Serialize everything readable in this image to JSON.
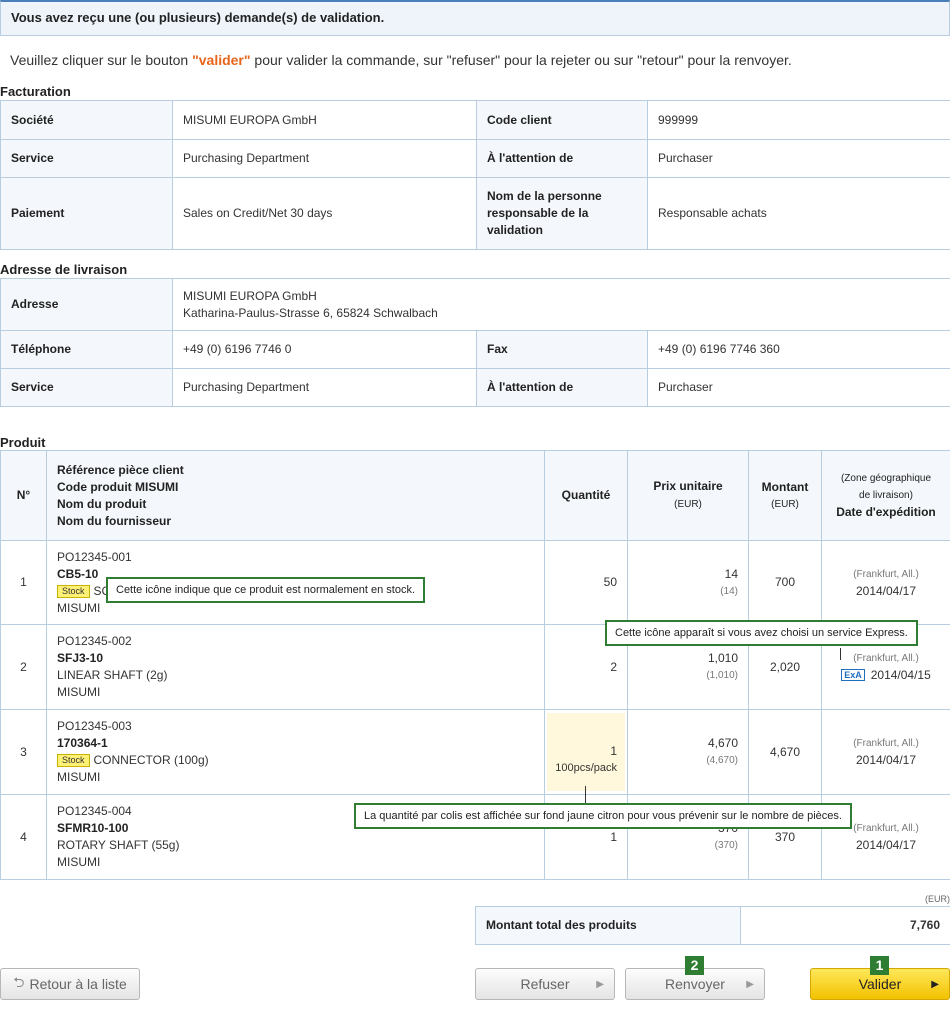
{
  "banner": "Vous avez reçu une (ou plusieurs) demande(s) de validation.",
  "instructions": {
    "before": "Veuillez cliquer sur le bouton ",
    "highlight": "\"valider\"",
    "after": " pour valider la commande, sur \"refuser\" pour la rejeter ou sur \"retour\" pour la renvoyer."
  },
  "billing": {
    "title": "Facturation",
    "societe_label": "Société",
    "societe_value": "MISUMI EUROPA GmbH",
    "code_client_label": "Code client",
    "code_client_value": "999999",
    "service_label": "Service",
    "service_value": "Purchasing Department",
    "attention_label": "À l'attention de",
    "attention_value": "Purchaser",
    "paiement_label": "Paiement",
    "paiement_value": "Sales on Credit/Net 30 days",
    "responsable_label": "Nom de la personne responsable de la validation",
    "responsable_value": "Responsable achats"
  },
  "delivery": {
    "title": "Adresse de livraison",
    "adresse_label": "Adresse",
    "adresse_line1": "MISUMI EUROPA GmbH",
    "adresse_line2": "Katharina-Paulus-Strasse 6, 65824 Schwalbach",
    "telephone_label": "Téléphone",
    "telephone_value": "+49 (0) 6196 7746 0",
    "fax_label": "Fax",
    "fax_value": "+49 (0) 6196 7746 360",
    "service_label": "Service",
    "service_value": "Purchasing Department",
    "attention_label": "À l'attention de",
    "attention_value": "Purchaser"
  },
  "products": {
    "title": "Produit",
    "headers": {
      "no": "N°",
      "ref_line1": "Référence pièce client",
      "ref_line2": "Code produit MISUMI",
      "ref_line3": "Nom du produit",
      "ref_line4": "Nom du fournisseur",
      "quantite": "Quantité",
      "prix": "Prix unitaire",
      "prix_unit": "(EUR)",
      "montant": "Montant",
      "montant_unit": "(EUR)",
      "zone_line1": "(Zone géographique",
      "zone_line2": "de livraison)",
      "date": "Date d'expédition"
    },
    "stock_badge": "Stock",
    "rows": [
      {
        "no": "1",
        "ref": "PO12345-001",
        "code": "CB5-10",
        "name": "SC",
        "supplier": "MISUMI",
        "qty": "50",
        "pack": "",
        "price": "14",
        "price_sub": "(14)",
        "amount": "700",
        "zone": "(Frankfurt, All.)",
        "date": "2014/04/17"
      },
      {
        "no": "2",
        "ref": "PO12345-002",
        "code": "SFJ3-10",
        "name": "LINEAR SHAFT (2g)",
        "supplier": "MISUMI",
        "qty": "2",
        "pack": "",
        "price": "1,010",
        "price_sub": "(1,010)",
        "amount": "2,020",
        "zone": "(Frankfurt, All.)",
        "date": "2014/04/15",
        "express": "ExA"
      },
      {
        "no": "3",
        "ref": "PO12345-003",
        "code": "170364-1",
        "name": "CONNECTOR (100g)",
        "supplier": "MISUMI",
        "qty": "1",
        "pack": "100pcs/pack",
        "price": "4,670",
        "price_sub": "(4,670)",
        "amount": "4,670",
        "zone": "(Frankfurt, All.)",
        "date": "2014/04/17"
      },
      {
        "no": "4",
        "ref": "PO12345-004",
        "code": "SFMR10-100",
        "name": "ROTARY SHAFT (55g)",
        "supplier": "MISUMI",
        "qty": "1",
        "pack": "",
        "price": "370",
        "price_sub": "(370)",
        "amount": "370",
        "zone": "(Frankfurt, All.)",
        "date": "2014/04/17"
      }
    ]
  },
  "callouts": {
    "stock": "Cette icône indique que ce produit est normalement en stock.",
    "express": "Cette icône apparaît si vous avez choisi un service Express.",
    "pack": "La quantité par colis est affichée sur fond jaune citron pour vous prévenir sur le nombre de pièces."
  },
  "totals": {
    "currency": "(EUR)",
    "label": "Montant total des produits",
    "value": "7,760"
  },
  "buttons": {
    "back": "Retour à la liste",
    "refuse": "Refuser",
    "return": "Renvoyer",
    "validate": "Valider",
    "badge_return": "2",
    "badge_validate": "1"
  },
  "colors": {
    "accent_orange": "#e8641a",
    "callout_green": "#2e7d32",
    "valider_yellow": "#f2c100",
    "border_blue": "#b9cde0"
  }
}
